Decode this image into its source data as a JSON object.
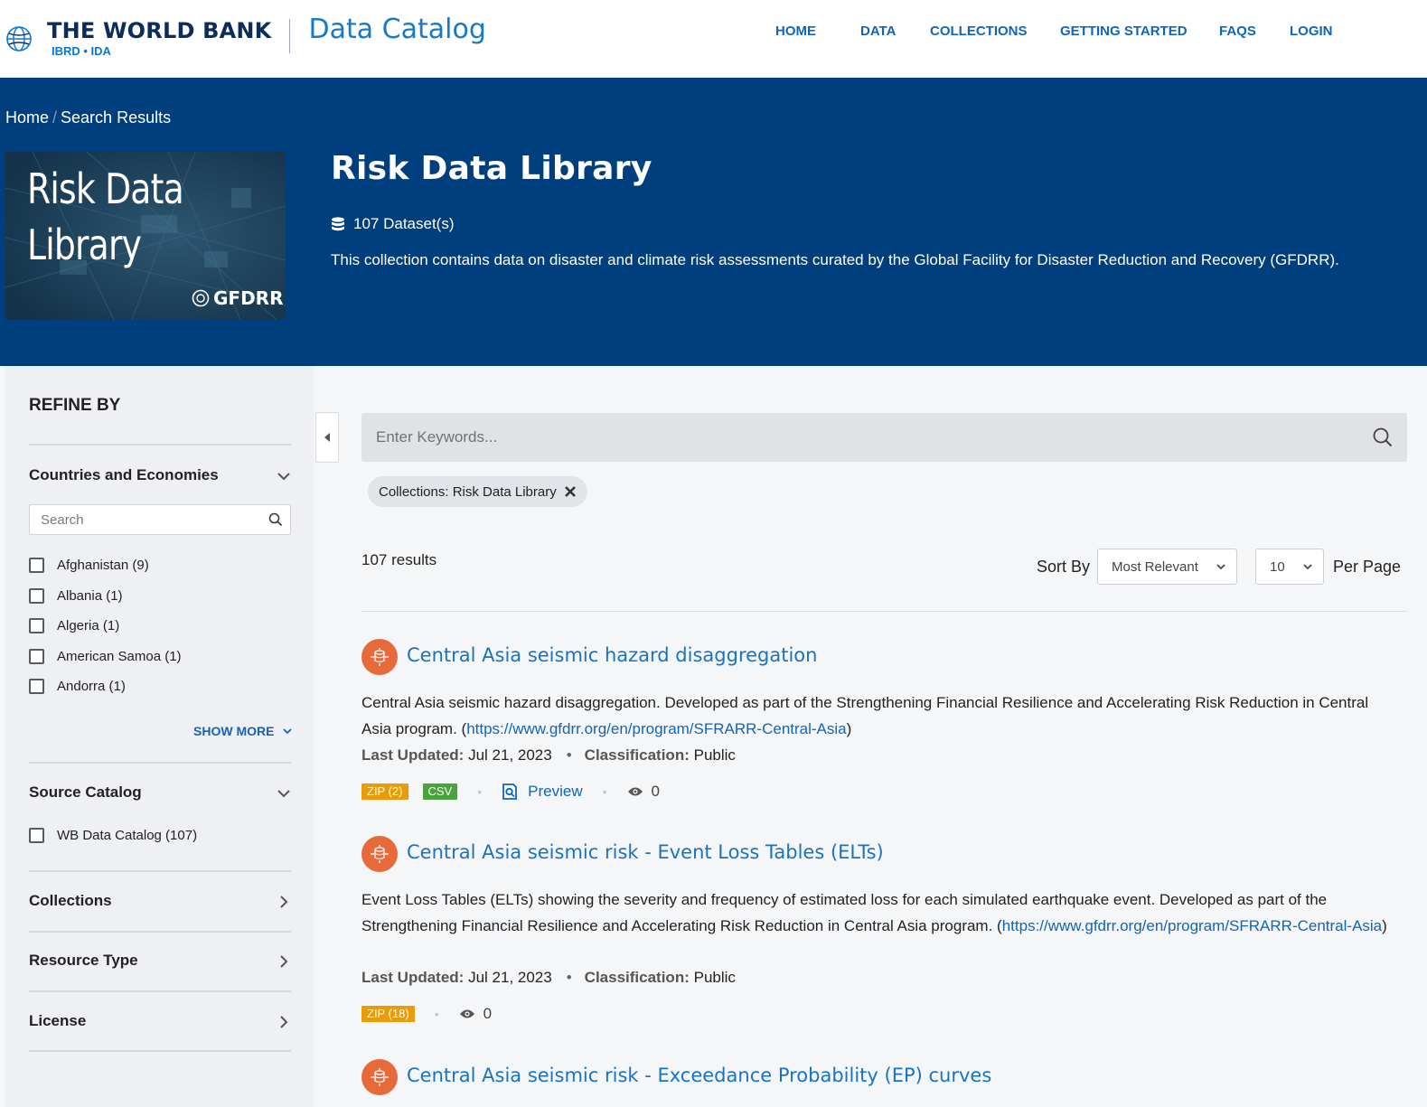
{
  "header": {
    "org_name": "THE WORLD BANK",
    "org_sub": "IBRD • IDA",
    "catalog_title": "Data Catalog",
    "nav": [
      "HOME",
      "DATA",
      "COLLECTIONS",
      "GETTING STARTED",
      "FAQS",
      "LOGIN"
    ]
  },
  "breadcrumb": {
    "home": "Home",
    "separator": "/",
    "current": "Search Results"
  },
  "collection": {
    "cover_title_line1": "Risk Data",
    "cover_title_line2": "Library",
    "cover_logo": "GFDRR",
    "title": "Risk Data Library",
    "dataset_count": "107 Dataset(s)",
    "description": "This collection contains data on disaster and climate risk assessments curated by the Global Facility for Disaster Reduction and Recovery (GFDRR)."
  },
  "sidebar": {
    "heading": "REFINE BY",
    "countries": {
      "label": "Countries and Economies",
      "search_placeholder": "Search",
      "items": [
        "Afghanistan (9)",
        "Albania (1)",
        "Algeria (1)",
        "American Samoa (1)",
        "Andorra (1)"
      ],
      "show_more": "SHOW MORE"
    },
    "source_catalog": {
      "label": "Source Catalog",
      "items": [
        "WB Data Catalog (107)"
      ]
    },
    "collections_label": "Collections",
    "resource_type_label": "Resource Type",
    "license_label": "License"
  },
  "search": {
    "placeholder": "Enter Keywords...",
    "active_filter": "Collections: Risk Data Library"
  },
  "results": {
    "count": "107 results",
    "sort_label": "Sort By",
    "sort_value": "Most Relevant",
    "per_page_value": "10",
    "per_page_label": "Per Page",
    "items": [
      {
        "title": "Central Asia seismic hazard disaggregation",
        "desc_text": "Central Asia seismic hazard disaggregation. Developed as part of the Strengthening Financial Resilience and Accelerating Risk Reduction in Central Asia program. (",
        "link": "https://www.gfdrr.org/en/program/SFRARR-Central-Asia",
        "desc_end": ")",
        "updated_key": "Last Updated:",
        "updated": "Jul 21, 2023",
        "class_key": "Classification:",
        "classification": "Public",
        "zip": "ZIP (2)",
        "csv": "CSV",
        "preview": "Preview",
        "views": "0"
      },
      {
        "title": "Central Asia seismic risk - Event Loss Tables (ELTs)",
        "desc_text": "Event Loss Tables (ELTs) showing the severity and frequency of estimated loss for each simulated earthquake event. Developed as part of the Strengthening Financial Resilience and Accelerating Risk Reduction in Central Asia program. (",
        "link": "https://www.gfdrr.org/en/program/SFRARR-Central-Asia",
        "desc_end": ")",
        "updated_key": "Last Updated:",
        "updated": "Jul 21, 2023",
        "class_key": "Classification:",
        "classification": "Public",
        "zip": "ZIP (18)",
        "views": "0"
      },
      {
        "title": "Central Asia seismic risk - Exceedance Probability (EP) curves"
      }
    ]
  },
  "colors": {
    "hero_bg": "#003f7d",
    "nav_link": "#1165b8",
    "title_link": "#1873c3",
    "dataset_icon": "#e86a3a",
    "badge_zip": "#e99b09",
    "badge_csv": "#4aa33c"
  },
  "icons": [
    "globe-icon",
    "database-icon",
    "chevron-down-icon",
    "chevron-right-icon",
    "search-icon",
    "close-icon",
    "caret-left-icon",
    "dataset-icon",
    "preview-icon",
    "eye-icon"
  ]
}
